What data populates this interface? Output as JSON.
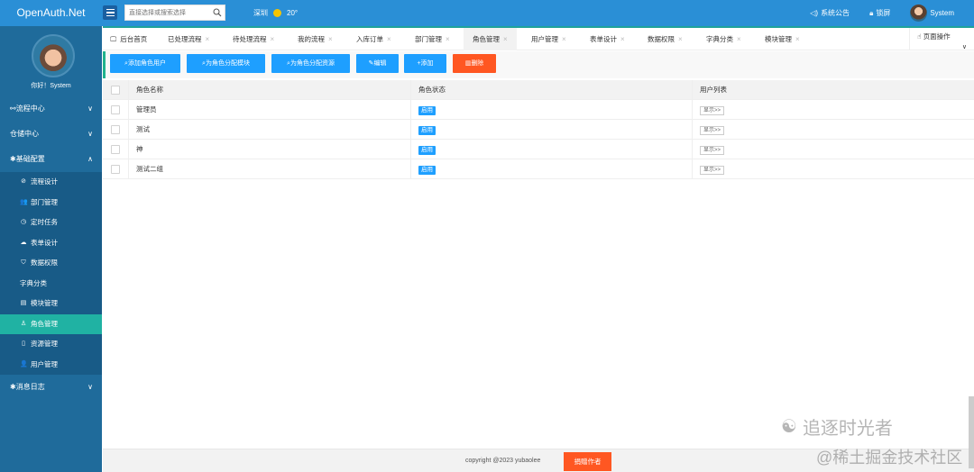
{
  "app": {
    "title": "OpenAuth.Net"
  },
  "search": {
    "placeholder": "直接选择或搜索选择"
  },
  "weather": {
    "city": "深圳",
    "temp": "20°"
  },
  "top_right": {
    "notice": "系统公告",
    "lock": "锁屏",
    "user": "System"
  },
  "sidebar": {
    "hello": "你好！System",
    "groups": [
      {
        "label": "流程中心",
        "arrow": "∨"
      },
      {
        "label": "仓储中心",
        "arrow": "∨"
      },
      {
        "label": "基础配置",
        "arrow": "∧"
      }
    ],
    "items": [
      {
        "label": "流程设计",
        "icon": "⊘"
      },
      {
        "label": "部门管理",
        "icon": "👥"
      },
      {
        "label": "定时任务",
        "icon": "◷"
      },
      {
        "label": "表单设计",
        "icon": "☁"
      },
      {
        "label": "数据权限",
        "icon": "⛉"
      },
      {
        "label": "字典分类",
        "icon": ""
      },
      {
        "label": "模块管理",
        "icon": "▤"
      },
      {
        "label": "角色管理",
        "icon": "♙"
      },
      {
        "label": "资源管理",
        "icon": "▯"
      },
      {
        "label": "用户管理",
        "icon": "👤"
      }
    ],
    "last_group": {
      "label": "消息日志",
      "arrow": "∨"
    }
  },
  "tabs": [
    {
      "label": "后台首页"
    },
    {
      "label": "已处理流程"
    },
    {
      "label": "待处理流程"
    },
    {
      "label": "我的流程"
    },
    {
      "label": "入库订单"
    },
    {
      "label": "部门管理"
    },
    {
      "label": "角色管理"
    },
    {
      "label": "用户管理"
    },
    {
      "label": "表单设计"
    },
    {
      "label": "数据权限"
    },
    {
      "label": "字典分类"
    },
    {
      "label": "模块管理"
    }
  ],
  "page_ops": "页面操作",
  "toolbar": {
    "add_role_user": "添加角色用户",
    "assign_module": "为角色分配模块",
    "assign_resource": "为角色分配资源",
    "edit": "编辑",
    "add": "添加",
    "delete": "删除"
  },
  "table": {
    "headers": [
      "角色名称",
      "角色状态",
      "用户列表"
    ],
    "rows": [
      {
        "name": "管理员",
        "status": "启用",
        "action": "显示>>"
      },
      {
        "name": "测试",
        "status": "启用",
        "action": "显示>>"
      },
      {
        "name": "神",
        "status": "启用",
        "action": "显示>>"
      },
      {
        "name": "测试二组",
        "status": "启用",
        "action": "显示>>"
      }
    ]
  },
  "footer": {
    "copyright": "copyright @2023 yubaolee",
    "donate": "捐赠作者"
  },
  "watermark": {
    "line1": "追逐时光者",
    "line2": "@稀土掘金技术社区"
  },
  "colors": {
    "topbar": "#2a8fd6",
    "sidebar": "#1f6b9b",
    "accent": "#1e9fff",
    "active": "#20b2a3",
    "danger": "#ff5722"
  }
}
